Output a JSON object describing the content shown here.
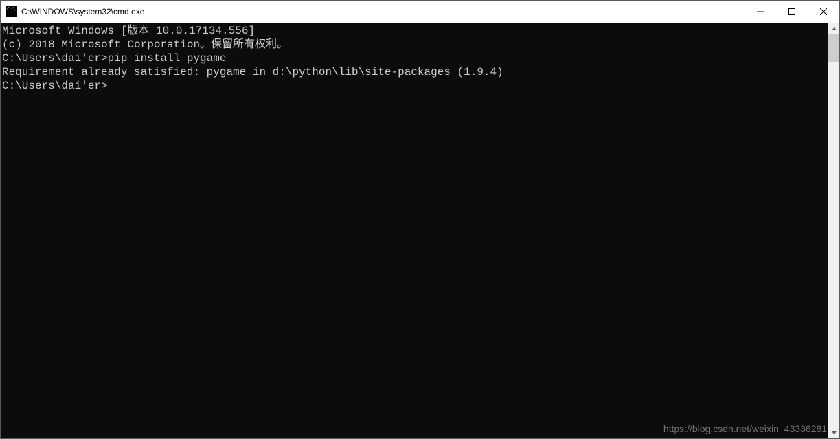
{
  "window": {
    "title": "C:\\WINDOWS\\system32\\cmd.exe"
  },
  "terminal": {
    "lines": [
      "Microsoft Windows [版本 10.0.17134.556]",
      "(c) 2018 Microsoft Corporation。保留所有权利。",
      "",
      "C:\\Users\\dai'er>pip install pygame",
      "Requirement already satisfied: pygame in d:\\python\\lib\\site-packages (1.9.4)",
      "",
      "C:\\Users\\dai'er>"
    ]
  },
  "watermark": "https://blog.csdn.net/weixin_43336281"
}
